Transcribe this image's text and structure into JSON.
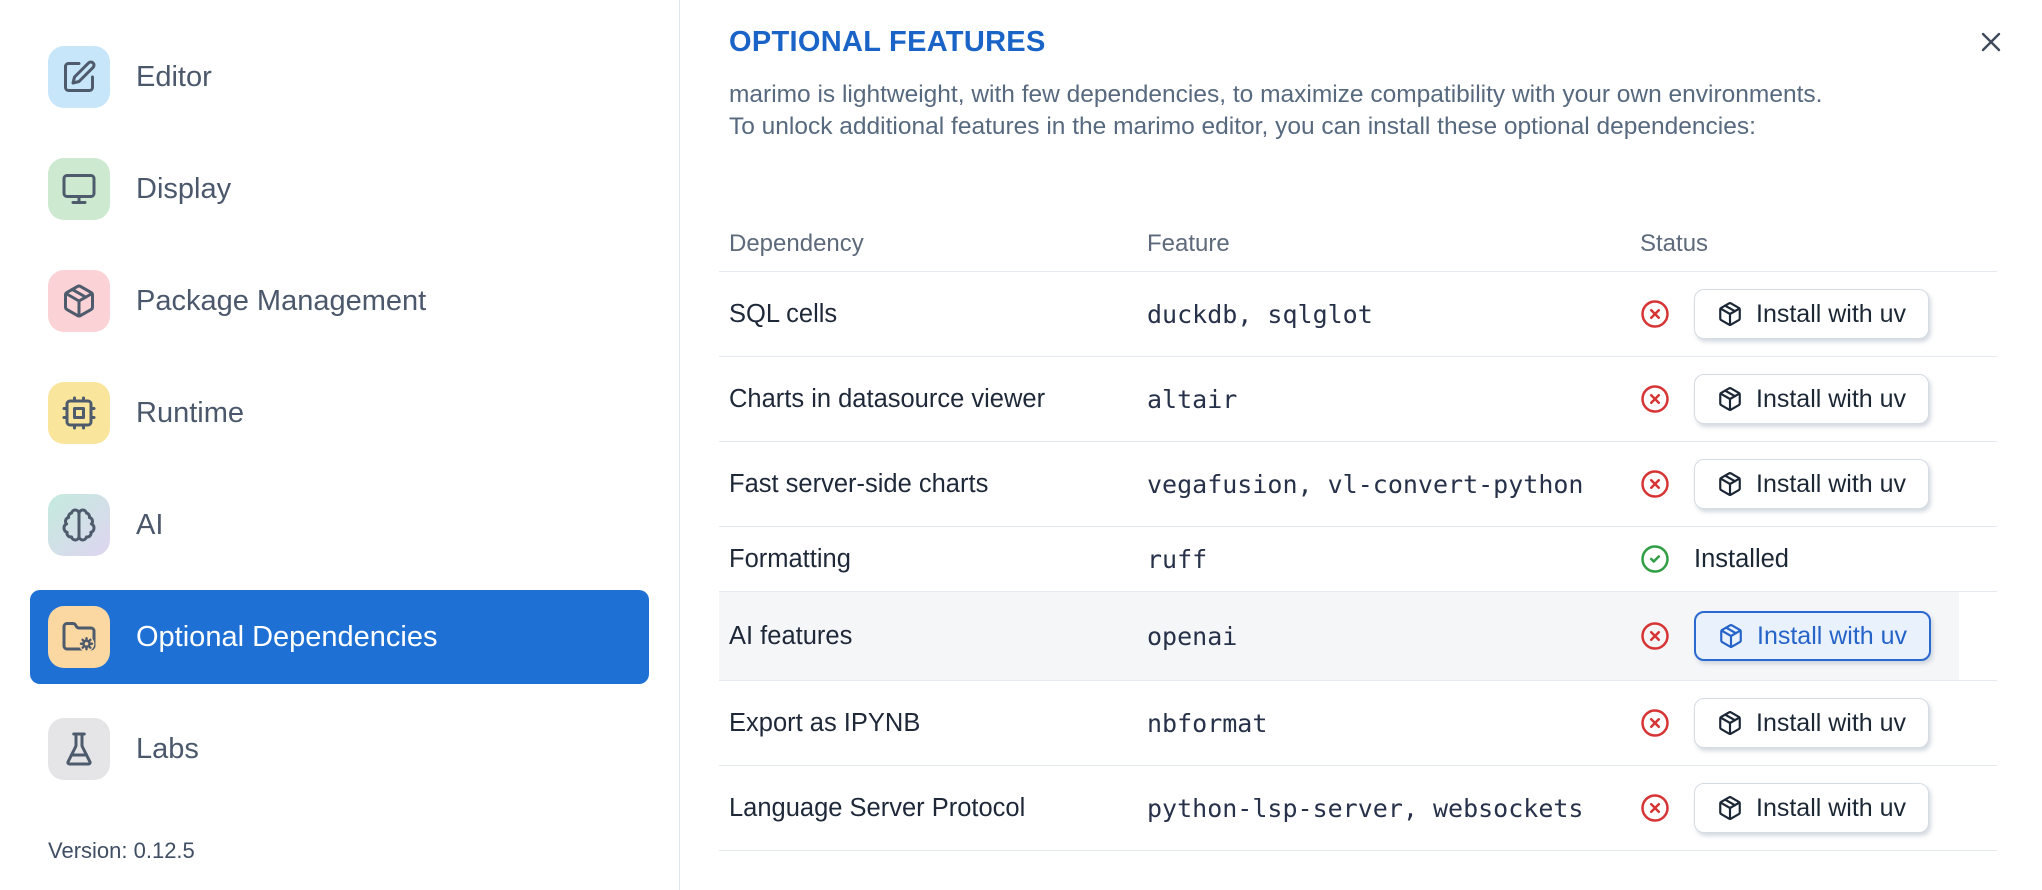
{
  "dialog": {
    "close_icon": "x-icon"
  },
  "sidebar": {
    "items": [
      {
        "label": "Editor",
        "icon": "square-pen",
        "chip_color": "#c7e6fa",
        "selected": false
      },
      {
        "label": "Display",
        "icon": "monitor",
        "chip_color": "#cdead0",
        "selected": false
      },
      {
        "label": "Package Management",
        "icon": "package",
        "chip_color": "#fbd3d6",
        "selected": false
      },
      {
        "label": "Runtime",
        "icon": "cpu",
        "chip_color": "#f9e69c",
        "selected": false
      },
      {
        "label": "AI",
        "icon": "brain",
        "chip_color": "linear-gradient(135deg,#c4ebdd,#ded5f1)",
        "selected": false
      },
      {
        "label": "Optional Dependencies",
        "icon": "folder-cog",
        "chip_color": "#fbd8a2",
        "selected": true
      },
      {
        "label": "Labs",
        "icon": "flask",
        "chip_color": "#e5e5e8",
        "selected": false
      }
    ],
    "version_label": "Version: 0.12.5"
  },
  "panel": {
    "title": "OPTIONAL FEATURES",
    "description_line1": "marimo is lightweight, with few dependencies, to maximize compatibility with your own environments.",
    "description_line2": "To unlock additional features in the marimo editor, you can install these optional dependencies:",
    "table": {
      "columns": [
        "Dependency",
        "Feature",
        "Status"
      ],
      "rows": [
        {
          "dependency": "SQL cells",
          "feature": "duckdb, sqlglot",
          "status": "not-installed",
          "action_label": "Install with uv",
          "highlighted": false
        },
        {
          "dependency": "Charts in datasource viewer",
          "feature": "altair",
          "status": "not-installed",
          "action_label": "Install with uv",
          "highlighted": false
        },
        {
          "dependency": "Fast server-side charts",
          "feature": "vegafusion, vl-convert-python",
          "status": "not-installed",
          "action_label": "Install with uv",
          "highlighted": false
        },
        {
          "dependency": "Formatting",
          "feature": "ruff",
          "status": "installed",
          "status_label": "Installed",
          "highlighted": false
        },
        {
          "dependency": "AI features",
          "feature": "openai",
          "status": "not-installed",
          "action_label": "Install with uv",
          "highlighted": true
        },
        {
          "dependency": "Export as IPYNB",
          "feature": "nbformat",
          "status": "not-installed",
          "action_label": "Install with uv",
          "highlighted": false
        },
        {
          "dependency": "Language Server Protocol",
          "feature": "python-lsp-server, websockets",
          "status": "not-installed",
          "action_label": "Install with uv",
          "highlighted": false
        }
      ]
    }
  },
  "colors": {
    "accent_blue": "#1a64c8",
    "selected_item_blue": "#1e70d5",
    "focused_button_border": "#2a6ad0",
    "focused_button_bg": "#e9f1fc",
    "error_red": "#d63535",
    "success_green": "#2f9e44",
    "divider": "#e4e9ef"
  }
}
